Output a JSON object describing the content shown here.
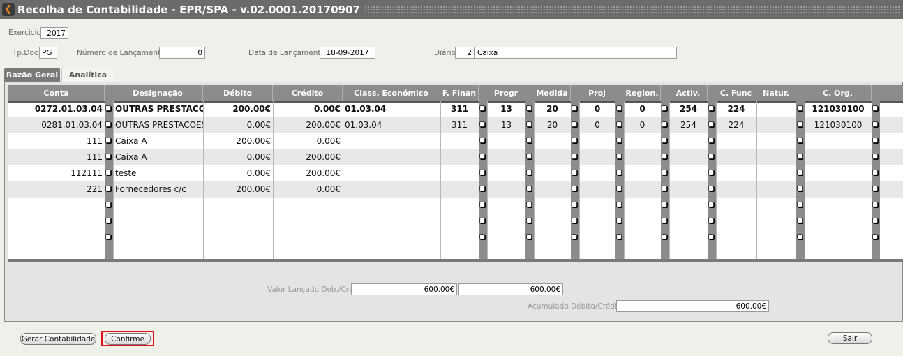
{
  "window": {
    "title": "Recolha de Contabilidade - EPR/SPA - v.02.0001.20170907"
  },
  "form": {
    "exercicio_label": "Exercicio",
    "exercicio": "2017",
    "tpdoc_label": "Tp.Doc.",
    "tpdoc": "PG",
    "numlanc_label": "Número de Lançamento:",
    "numlanc": "0",
    "datalanc_label": "Data de Lançamento:",
    "datalanc": "18-09-2017",
    "diario_label": "Diário:",
    "diario_code": "2",
    "diario_name": "Caixa"
  },
  "tabs": [
    {
      "label": "Razão Geral"
    },
    {
      "label": "Analítica"
    }
  ],
  "grid": {
    "headers": {
      "conta": "Conta",
      "designacao": "Designação",
      "debito": "Débito",
      "credito": "Crédito",
      "classeco": "Class. Económico",
      "finan": "F. Finan",
      "progr": "Progr",
      "medida": "Medida",
      "proj": "Proj",
      "region": "Region.",
      "activ": "Activ.",
      "cfunc": "C. Func",
      "natur": "Natur.",
      "corg": "C. Org."
    },
    "rows": [
      {
        "conta": "0272.01.03.04",
        "designacao": "OUTRAS PRESTACOES DE SERVICOS",
        "debito": "200.00€",
        "credito": "0.00€",
        "classeco": "01.03.04",
        "finan": "311",
        "progr": "13",
        "medida": "20",
        "proj": "0",
        "region": "0",
        "activ": "254",
        "cfunc": "224",
        "natur": "",
        "corg": "121030100"
      },
      {
        "conta": "0281.01.03.04",
        "designacao": "OUTRAS PRESTACOES DE SERVICOS",
        "debito": "0.00€",
        "credito": "200.00€",
        "classeco": "01.03.04",
        "finan": "311",
        "progr": "13",
        "medida": "20",
        "proj": "0",
        "region": "0",
        "activ": "254",
        "cfunc": "224",
        "natur": "",
        "corg": "121030100"
      },
      {
        "conta": "111",
        "designacao": "Caixa A",
        "debito": "200.00€",
        "credito": "0.00€",
        "classeco": "",
        "finan": "",
        "progr": "",
        "medida": "",
        "proj": "",
        "region": "",
        "activ": "",
        "cfunc": "",
        "natur": "",
        "corg": ""
      },
      {
        "conta": "111",
        "designacao": "Caixa A",
        "debito": "0.00€",
        "credito": "200.00€",
        "classeco": "",
        "finan": "",
        "progr": "",
        "medida": "",
        "proj": "",
        "region": "",
        "activ": "",
        "cfunc": "",
        "natur": "",
        "corg": ""
      },
      {
        "conta": "112111",
        "designacao": "teste",
        "debito": "0.00€",
        "credito": "200.00€",
        "classeco": "",
        "finan": "",
        "progr": "",
        "medida": "",
        "proj": "",
        "region": "",
        "activ": "",
        "cfunc": "",
        "natur": "",
        "corg": ""
      },
      {
        "conta": "221",
        "designacao": "Fornecedores c/c",
        "debito": "200.00€",
        "credito": "0.00€",
        "classeco": "",
        "finan": "",
        "progr": "",
        "medida": "",
        "proj": "",
        "region": "",
        "activ": "",
        "cfunc": "",
        "natur": "",
        "corg": ""
      }
    ]
  },
  "totals": {
    "valor_label": "Valor Lançado Deb./Cre.",
    "valor_deb": "600.00€",
    "valor_cre": "600.00€",
    "acum_label": "Acumulado Débito/Crédito:",
    "acum": "600.00€"
  },
  "buttons": {
    "gerar": "Gerar Contabilidade",
    "confirme": "Confirme",
    "sair": "Sair"
  }
}
